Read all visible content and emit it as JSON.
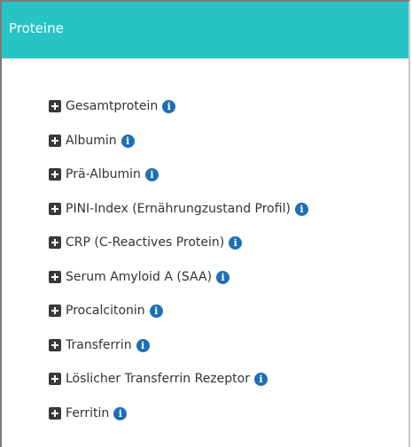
{
  "panel": {
    "title": "Proteine",
    "header_color": "#27c4c4"
  },
  "icons": {
    "expand": "plus-square-icon",
    "info": "info-circle-icon",
    "info_glyph": "i"
  },
  "items": [
    {
      "label": "Gesamtprotein"
    },
    {
      "label": "Albumin"
    },
    {
      "label": "Prä-Albumin"
    },
    {
      "label": "PINI-Index (Ernährungzustand Profil)"
    },
    {
      "label": "CRP (C-Reactives Protein)"
    },
    {
      "label": "Serum Amyloid A (SAA)"
    },
    {
      "label": "Procalcitonin"
    },
    {
      "label": "Transferrin"
    },
    {
      "label": "Löslicher Transferrin Rezeptor"
    },
    {
      "label": "Ferritin"
    }
  ]
}
